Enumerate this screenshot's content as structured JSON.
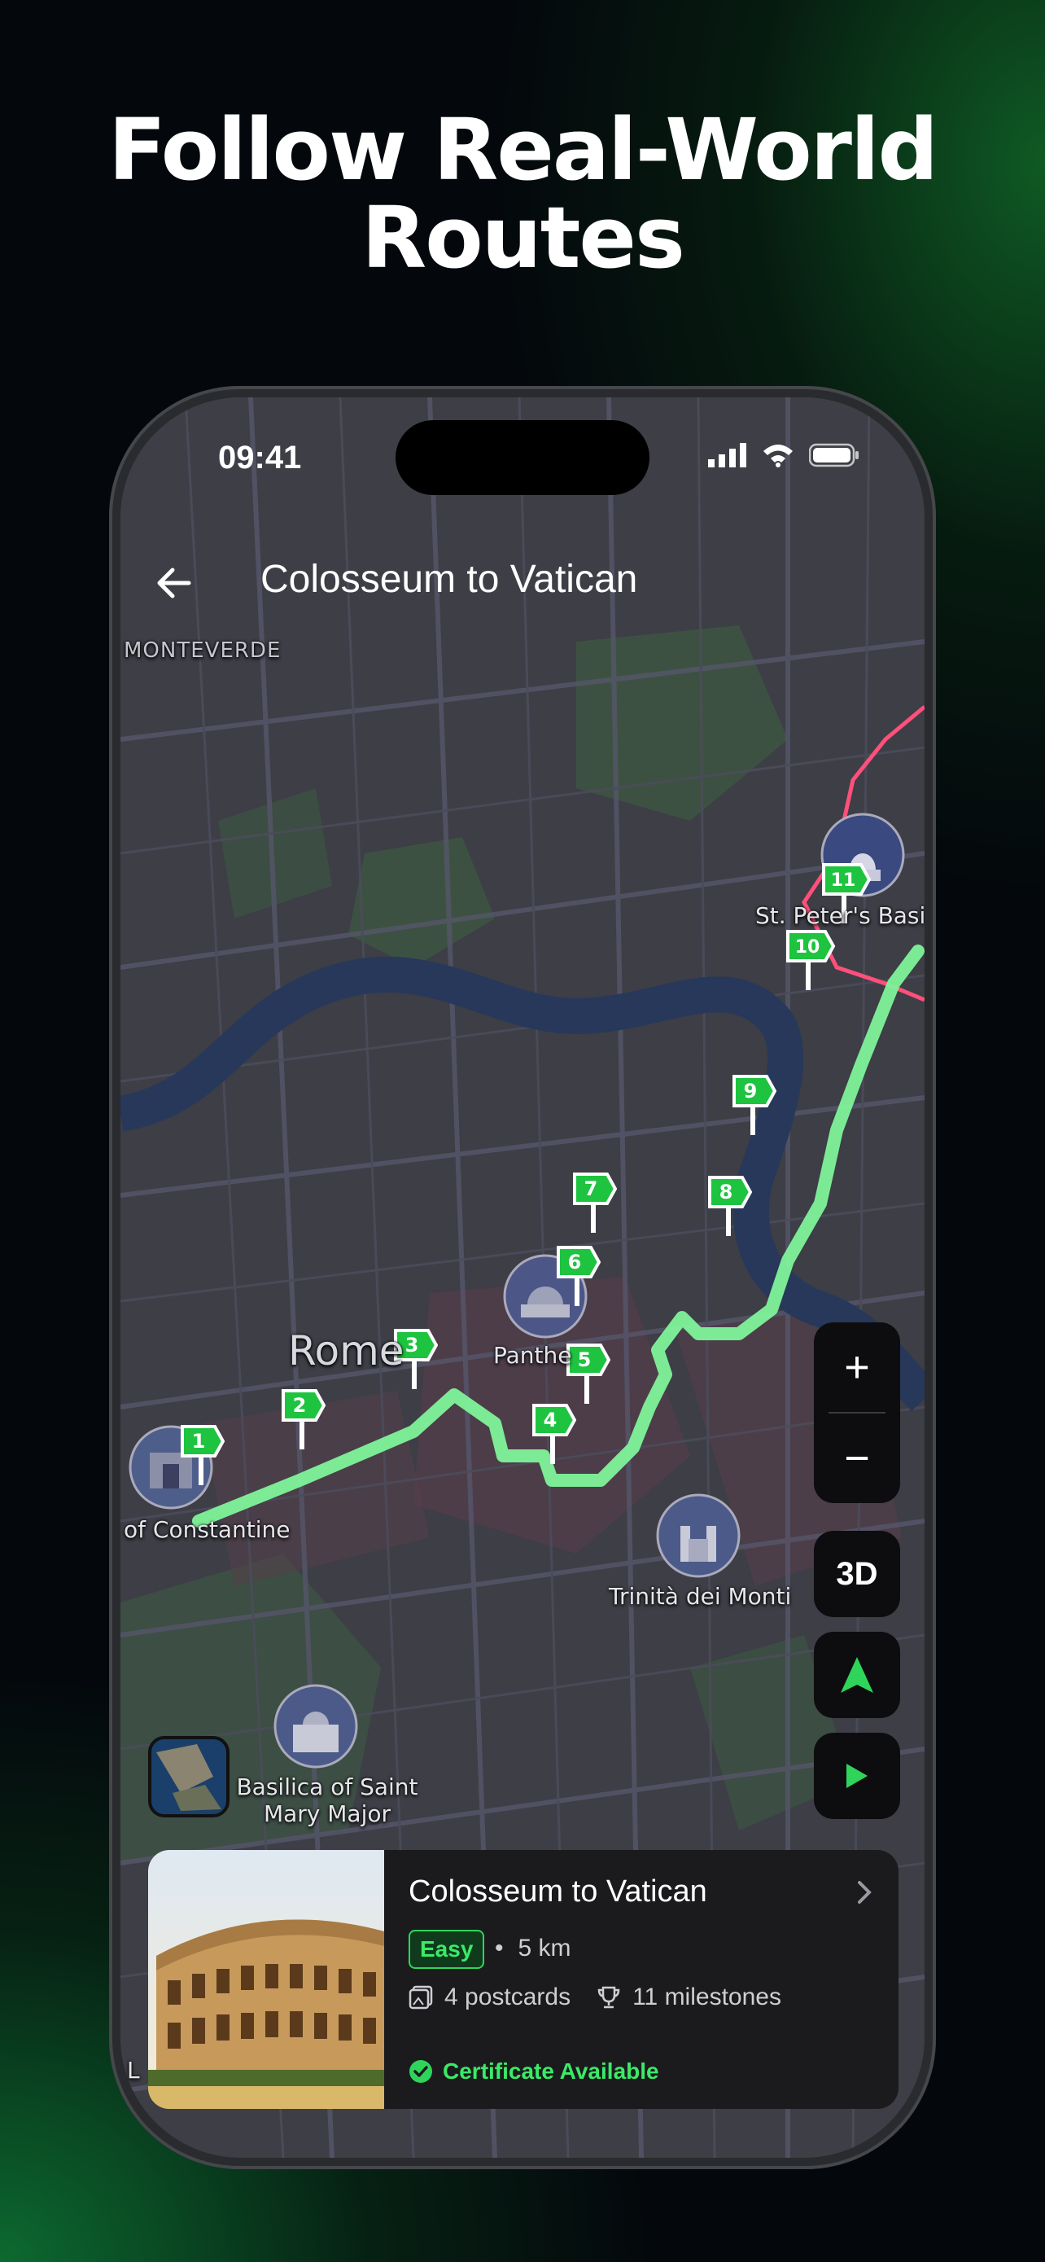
{
  "headline": {
    "line1": "Follow Real-World",
    "line2": "Routes"
  },
  "status": {
    "time": "09:41"
  },
  "header": {
    "title": "Colosseum to Vatican"
  },
  "map": {
    "district": "MONTEVERDE",
    "city": "Rome",
    "landmarks": {
      "constantine": "of Constantine",
      "pantheon": "Panthe",
      "st_peters": "St. Peter's Basi",
      "trinita": "Trinità dei Monti",
      "mary_major_1": "Basilica of Saint",
      "mary_major_2": "Mary Major"
    },
    "milestones": [
      "1",
      "2",
      "3",
      "4",
      "5",
      "6",
      "7",
      "8",
      "9",
      "10",
      "11"
    ],
    "route_color": "#7ff39a",
    "pin_color": "#1ec33f",
    "border_color": "#ff4f7b",
    "edge_letter": "L"
  },
  "controls": {
    "zoom_in": "+",
    "zoom_out": "−",
    "mode_3d": "3D"
  },
  "card": {
    "title": "Colosseum to Vatican",
    "difficulty": "Easy",
    "distance": "5 km",
    "postcards": "4 postcards",
    "milestones": "11 milestones",
    "certificate": "Certificate Available",
    "accent": "#3bea67"
  }
}
